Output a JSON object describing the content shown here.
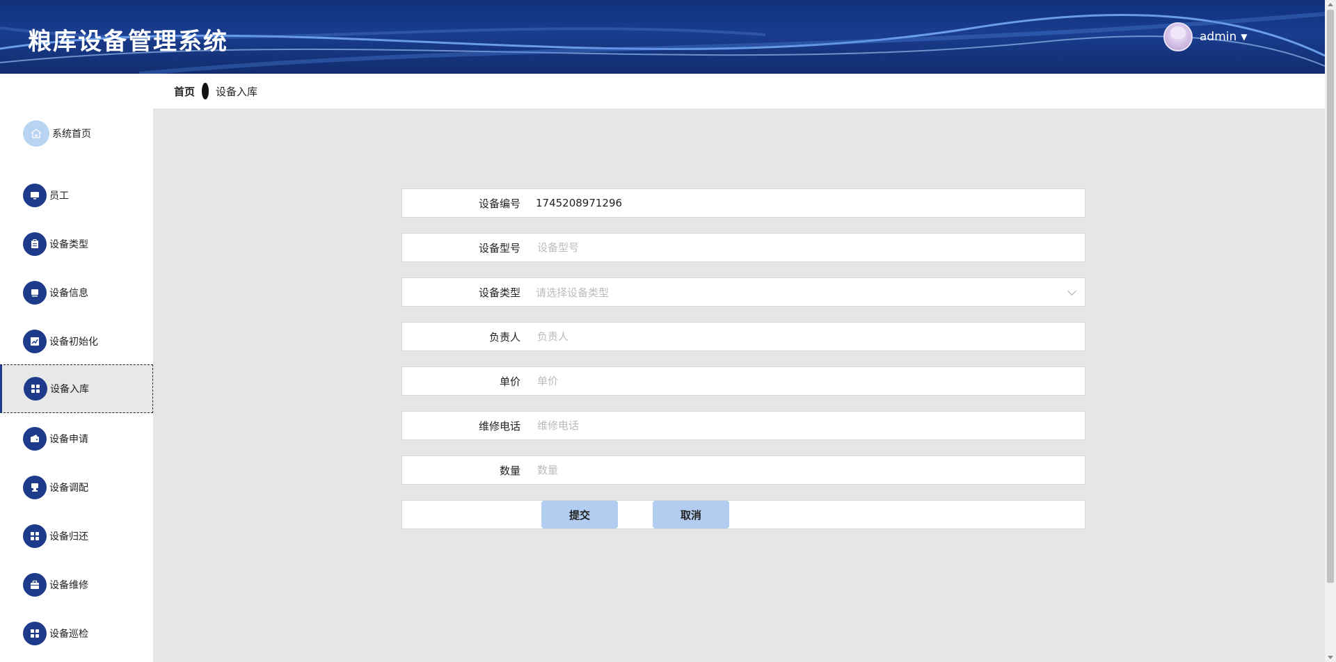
{
  "header": {
    "title": "粮库设备管理系统",
    "username": "admin",
    "caret": "▼"
  },
  "breadcrumb": {
    "home": "首页",
    "current": "设备入库"
  },
  "sidebar": {
    "items": [
      {
        "label": "系统首页",
        "icon": "home-icon"
      },
      {
        "label": "员工",
        "icon": "monitor-icon"
      },
      {
        "label": "设备类型",
        "icon": "clipboard-icon"
      },
      {
        "label": "设备信息",
        "icon": "display-icon"
      },
      {
        "label": "设备初始化",
        "icon": "chart-icon"
      },
      {
        "label": "设备入库",
        "icon": "grid-icon",
        "active": true
      },
      {
        "label": "设备申请",
        "icon": "wallet-icon"
      },
      {
        "label": "设备调配",
        "icon": "stamp-icon"
      },
      {
        "label": "设备归还",
        "icon": "grid-icon"
      },
      {
        "label": "设备维修",
        "icon": "briefcase-icon"
      },
      {
        "label": "设备巡检",
        "icon": "grid-icon"
      }
    ]
  },
  "form": {
    "device_no": {
      "label": "设备编号",
      "value": "1745208971296"
    },
    "device_model": {
      "label": "设备型号",
      "placeholder": "设备型号"
    },
    "device_type": {
      "label": "设备类型",
      "placeholder": "请选择设备类型"
    },
    "owner": {
      "label": "负责人",
      "placeholder": "负责人"
    },
    "unit_price": {
      "label": "单价",
      "placeholder": "单价"
    },
    "repair_phone": {
      "label": "维修电话",
      "placeholder": "维修电话"
    },
    "quantity": {
      "label": "数量",
      "placeholder": "数量"
    },
    "submit_label": "提交",
    "cancel_label": "取消"
  },
  "colors": {
    "header_bg": "#1a3d8f",
    "icon_bg": "#1e3a8a",
    "button_bg": "#b2cdf0",
    "content_bg": "#e6e6e6"
  }
}
